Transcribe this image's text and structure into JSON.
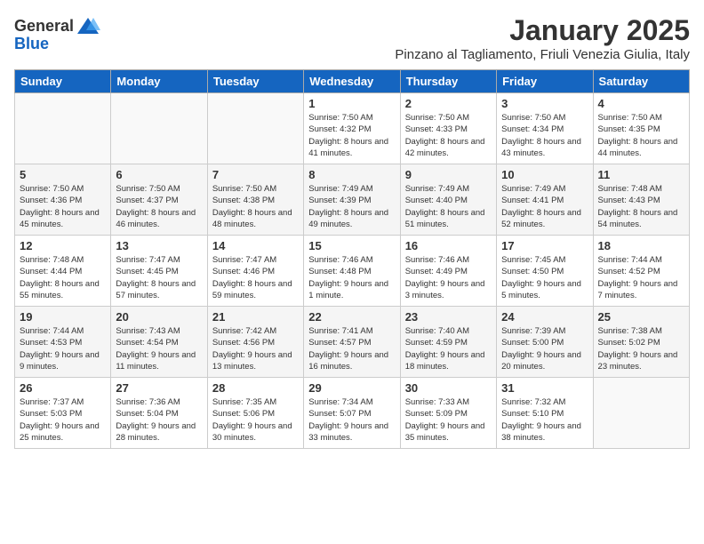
{
  "header": {
    "logo_general": "General",
    "logo_blue": "Blue",
    "month": "January 2025",
    "location": "Pinzano al Tagliamento, Friuli Venezia Giulia, Italy"
  },
  "weekdays": [
    "Sunday",
    "Monday",
    "Tuesday",
    "Wednesday",
    "Thursday",
    "Friday",
    "Saturday"
  ],
  "weeks": [
    [
      {
        "day": "",
        "info": ""
      },
      {
        "day": "",
        "info": ""
      },
      {
        "day": "",
        "info": ""
      },
      {
        "day": "1",
        "info": "Sunrise: 7:50 AM\nSunset: 4:32 PM\nDaylight: 8 hours and 41 minutes."
      },
      {
        "day": "2",
        "info": "Sunrise: 7:50 AM\nSunset: 4:33 PM\nDaylight: 8 hours and 42 minutes."
      },
      {
        "day": "3",
        "info": "Sunrise: 7:50 AM\nSunset: 4:34 PM\nDaylight: 8 hours and 43 minutes."
      },
      {
        "day": "4",
        "info": "Sunrise: 7:50 AM\nSunset: 4:35 PM\nDaylight: 8 hours and 44 minutes."
      }
    ],
    [
      {
        "day": "5",
        "info": "Sunrise: 7:50 AM\nSunset: 4:36 PM\nDaylight: 8 hours and 45 minutes."
      },
      {
        "day": "6",
        "info": "Sunrise: 7:50 AM\nSunset: 4:37 PM\nDaylight: 8 hours and 46 minutes."
      },
      {
        "day": "7",
        "info": "Sunrise: 7:50 AM\nSunset: 4:38 PM\nDaylight: 8 hours and 48 minutes."
      },
      {
        "day": "8",
        "info": "Sunrise: 7:49 AM\nSunset: 4:39 PM\nDaylight: 8 hours and 49 minutes."
      },
      {
        "day": "9",
        "info": "Sunrise: 7:49 AM\nSunset: 4:40 PM\nDaylight: 8 hours and 51 minutes."
      },
      {
        "day": "10",
        "info": "Sunrise: 7:49 AM\nSunset: 4:41 PM\nDaylight: 8 hours and 52 minutes."
      },
      {
        "day": "11",
        "info": "Sunrise: 7:48 AM\nSunset: 4:43 PM\nDaylight: 8 hours and 54 minutes."
      }
    ],
    [
      {
        "day": "12",
        "info": "Sunrise: 7:48 AM\nSunset: 4:44 PM\nDaylight: 8 hours and 55 minutes."
      },
      {
        "day": "13",
        "info": "Sunrise: 7:47 AM\nSunset: 4:45 PM\nDaylight: 8 hours and 57 minutes."
      },
      {
        "day": "14",
        "info": "Sunrise: 7:47 AM\nSunset: 4:46 PM\nDaylight: 8 hours and 59 minutes."
      },
      {
        "day": "15",
        "info": "Sunrise: 7:46 AM\nSunset: 4:48 PM\nDaylight: 9 hours and 1 minute."
      },
      {
        "day": "16",
        "info": "Sunrise: 7:46 AM\nSunset: 4:49 PM\nDaylight: 9 hours and 3 minutes."
      },
      {
        "day": "17",
        "info": "Sunrise: 7:45 AM\nSunset: 4:50 PM\nDaylight: 9 hours and 5 minutes."
      },
      {
        "day": "18",
        "info": "Sunrise: 7:44 AM\nSunset: 4:52 PM\nDaylight: 9 hours and 7 minutes."
      }
    ],
    [
      {
        "day": "19",
        "info": "Sunrise: 7:44 AM\nSunset: 4:53 PM\nDaylight: 9 hours and 9 minutes."
      },
      {
        "day": "20",
        "info": "Sunrise: 7:43 AM\nSunset: 4:54 PM\nDaylight: 9 hours and 11 minutes."
      },
      {
        "day": "21",
        "info": "Sunrise: 7:42 AM\nSunset: 4:56 PM\nDaylight: 9 hours and 13 minutes."
      },
      {
        "day": "22",
        "info": "Sunrise: 7:41 AM\nSunset: 4:57 PM\nDaylight: 9 hours and 16 minutes."
      },
      {
        "day": "23",
        "info": "Sunrise: 7:40 AM\nSunset: 4:59 PM\nDaylight: 9 hours and 18 minutes."
      },
      {
        "day": "24",
        "info": "Sunrise: 7:39 AM\nSunset: 5:00 PM\nDaylight: 9 hours and 20 minutes."
      },
      {
        "day": "25",
        "info": "Sunrise: 7:38 AM\nSunset: 5:02 PM\nDaylight: 9 hours and 23 minutes."
      }
    ],
    [
      {
        "day": "26",
        "info": "Sunrise: 7:37 AM\nSunset: 5:03 PM\nDaylight: 9 hours and 25 minutes."
      },
      {
        "day": "27",
        "info": "Sunrise: 7:36 AM\nSunset: 5:04 PM\nDaylight: 9 hours and 28 minutes."
      },
      {
        "day": "28",
        "info": "Sunrise: 7:35 AM\nSunset: 5:06 PM\nDaylight: 9 hours and 30 minutes."
      },
      {
        "day": "29",
        "info": "Sunrise: 7:34 AM\nSunset: 5:07 PM\nDaylight: 9 hours and 33 minutes."
      },
      {
        "day": "30",
        "info": "Sunrise: 7:33 AM\nSunset: 5:09 PM\nDaylight: 9 hours and 35 minutes."
      },
      {
        "day": "31",
        "info": "Sunrise: 7:32 AM\nSunset: 5:10 PM\nDaylight: 9 hours and 38 minutes."
      },
      {
        "day": "",
        "info": ""
      }
    ]
  ]
}
